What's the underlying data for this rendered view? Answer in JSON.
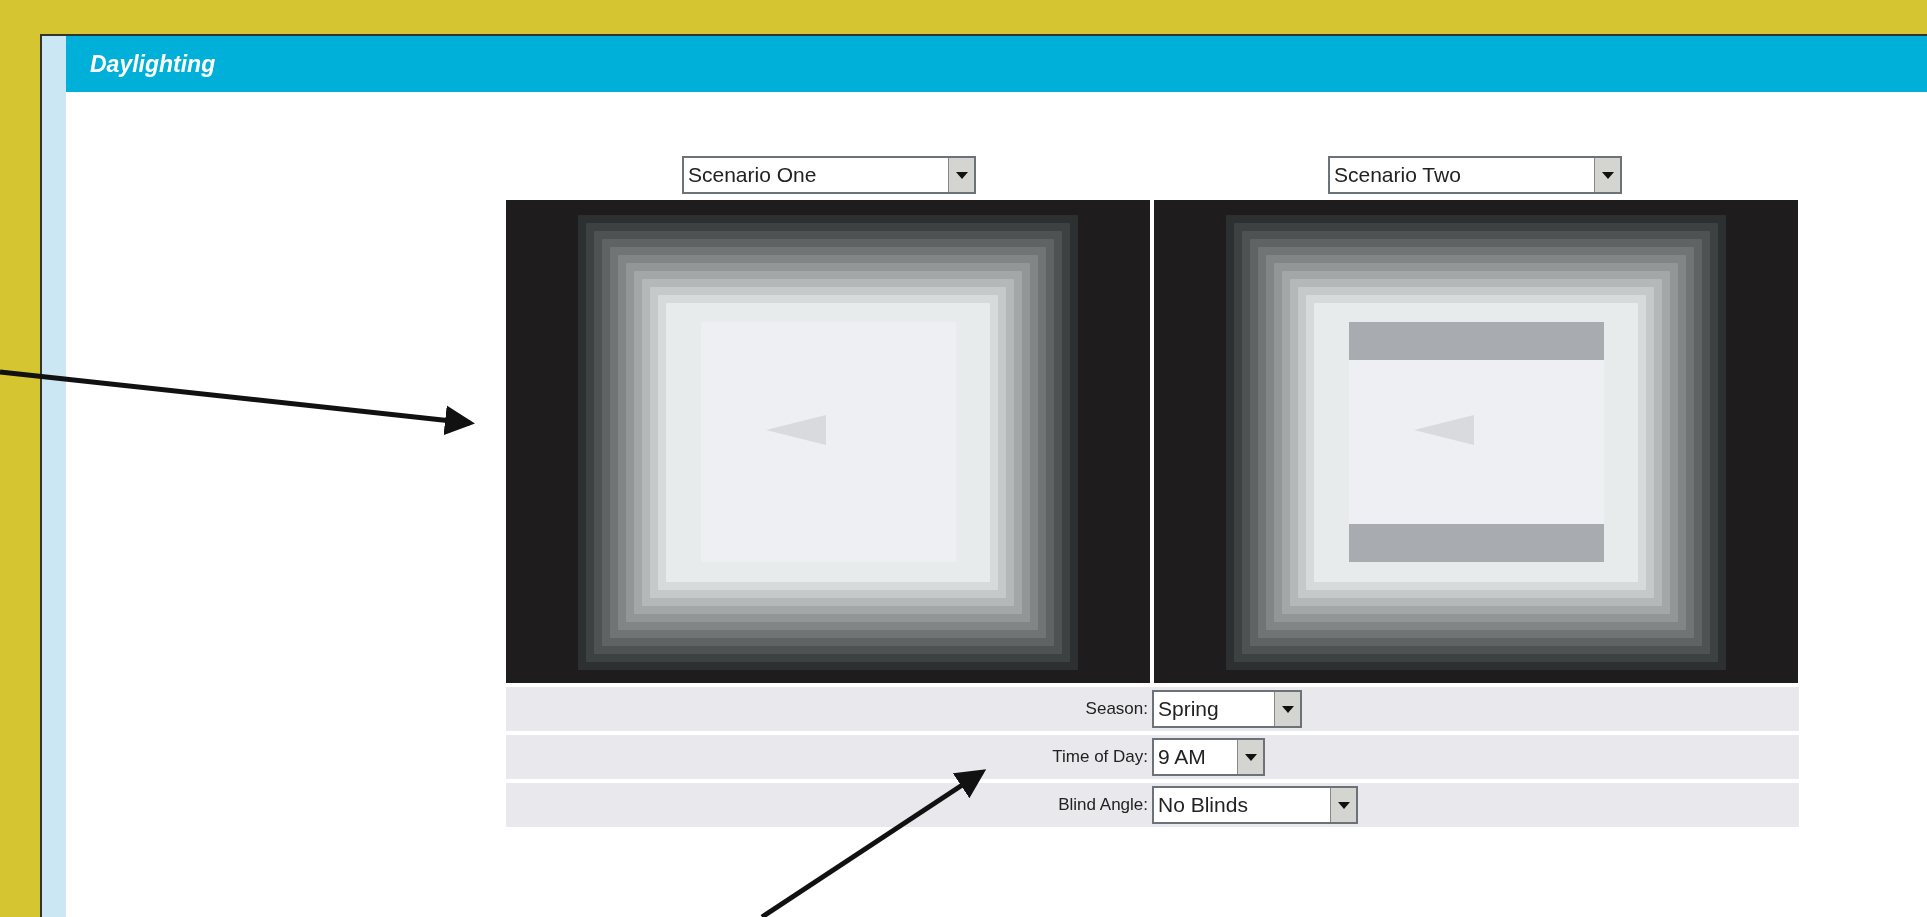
{
  "header": {
    "title": "Daylighting"
  },
  "scenarios": [
    {
      "value": "Scenario One",
      "blinds": false
    },
    {
      "value": "Scenario Two",
      "blinds": true
    }
  ],
  "settings": [
    {
      "label": "Season:",
      "value": "Spring"
    },
    {
      "label": "Time of Day:",
      "value": "9 AM"
    },
    {
      "label": "Blind Angle:",
      "value": "No Blinds"
    }
  ]
}
